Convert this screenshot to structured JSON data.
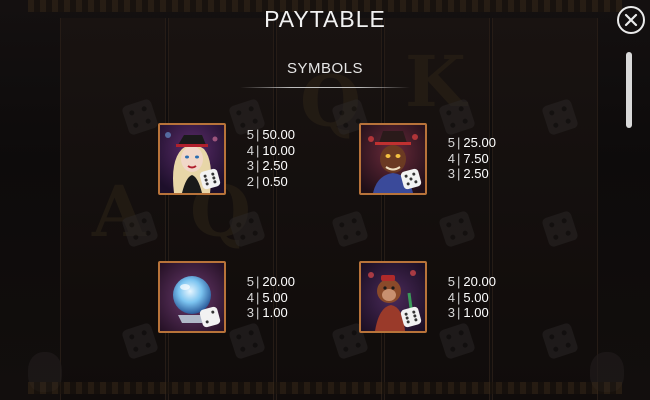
{
  "header": {
    "title": "PAYTABLE",
    "close_icon": "close-icon"
  },
  "section": {
    "title": "SYMBOLS"
  },
  "symbols": [
    {
      "name": "clown-girl",
      "pays": [
        {
          "count": "5",
          "amount": "50.00"
        },
        {
          "count": "4",
          "amount": "10.00"
        },
        {
          "count": "3",
          "amount": "2.50"
        },
        {
          "count": "2",
          "amount": "0.50"
        }
      ]
    },
    {
      "name": "ringmaster",
      "pays": [
        {
          "count": "5",
          "amount": "25.00"
        },
        {
          "count": "4",
          "amount": "7.50"
        },
        {
          "count": "3",
          "amount": "2.50"
        }
      ]
    },
    {
      "name": "crystal-ball",
      "pays": [
        {
          "count": "5",
          "amount": "20.00"
        },
        {
          "count": "4",
          "amount": "5.00"
        },
        {
          "count": "3",
          "amount": "1.00"
        }
      ]
    },
    {
      "name": "monkey",
      "pays": [
        {
          "count": "5",
          "amount": "20.00"
        },
        {
          "count": "4",
          "amount": "5.00"
        },
        {
          "count": "3",
          "amount": "1.00"
        }
      ]
    }
  ],
  "colors": {
    "accent": "#b8733a",
    "text": "#ededed",
    "background": "#0b0a0a"
  }
}
